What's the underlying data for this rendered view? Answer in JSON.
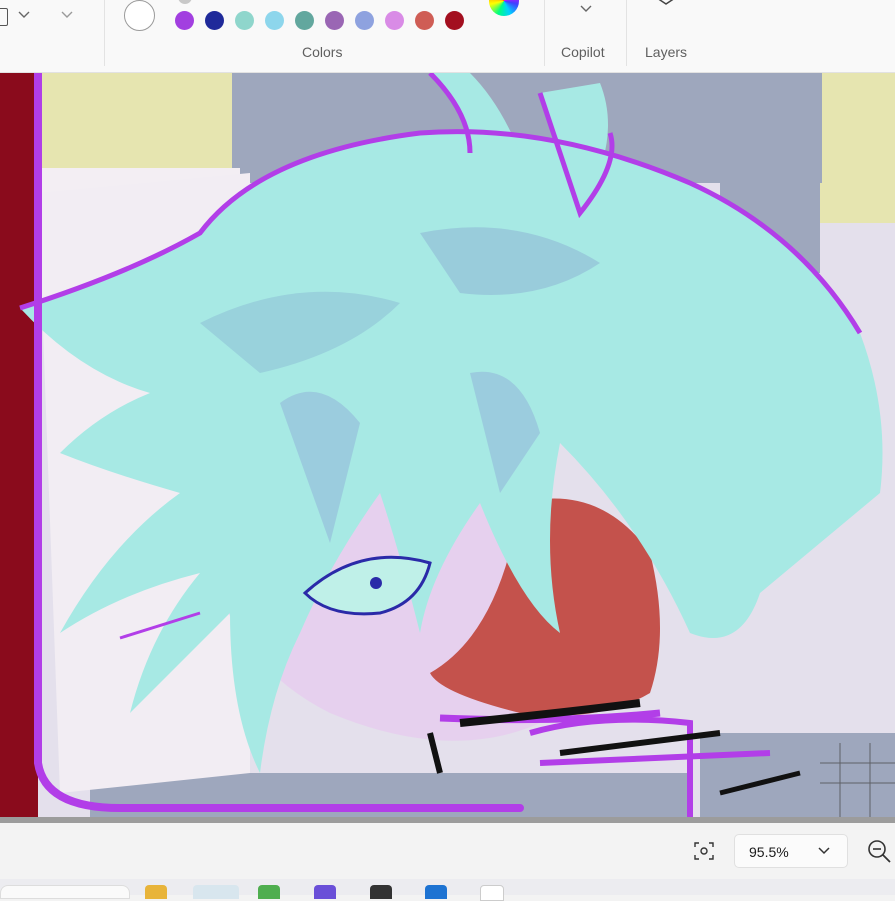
{
  "ribbon": {
    "colors_group_label": "Colors",
    "copilot_group_label": "Copilot",
    "layers_group_label": "Layers",
    "selected_color": "#ffffff",
    "palette": [
      "#a23fe0",
      "#1f2a9a",
      "#8fd6cc",
      "#8dd6ec",
      "#62a79e",
      "#9a66b4",
      "#8ea2df",
      "#d98be6",
      "#cf5d55",
      "#a30f1f"
    ],
    "icons": [
      "chevron-down-icon",
      "copilot-chevron-icon",
      "layers-icon",
      "rainbow-color-picker-icon"
    ]
  },
  "canvas": {
    "description_colors": {
      "hair": "#a7e9e4",
      "outline": "#b23ee8",
      "skin": "#e6d0ee",
      "blood": "#b2141e",
      "background_gray": "#9ea7bd",
      "background_yellow": "#e6e5b0",
      "left_bar": "#8a0b1c"
    }
  },
  "statusbar": {
    "zoom_value": "95.5%",
    "icons": [
      "fit-to-window-icon",
      "chevron-down-icon",
      "zoom-out-icon"
    ]
  }
}
